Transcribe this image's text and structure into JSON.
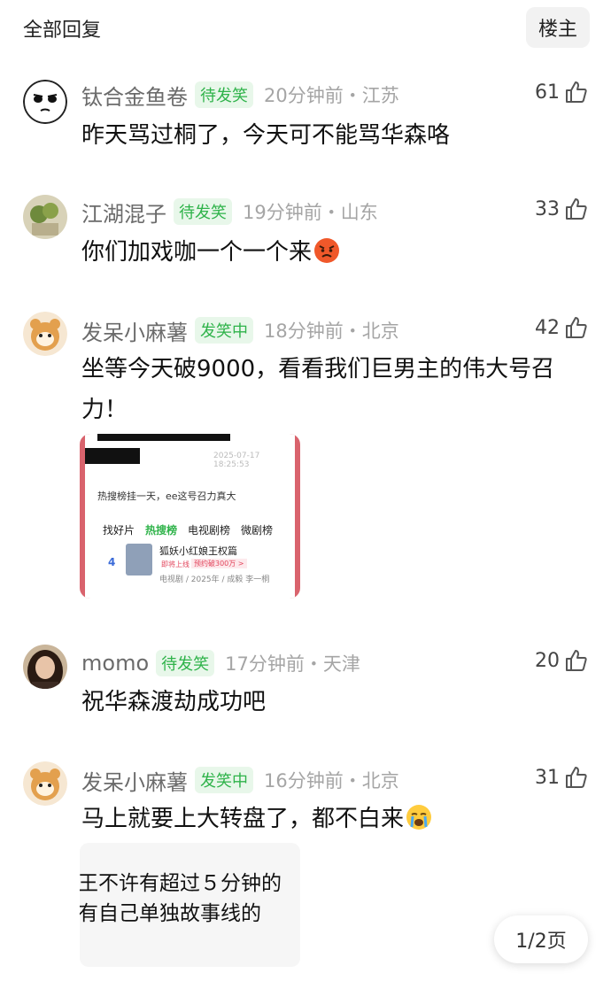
{
  "header": {
    "all_replies": "全部回复",
    "op_button": "楼主"
  },
  "comments": [
    {
      "user": "钛合金鱼卷",
      "badge": "待发笑",
      "time": "20分钟前・江苏",
      "likes": "61",
      "text": "昨天骂过桐了，今天可不能骂华森咯"
    },
    {
      "user": "江湖混子",
      "badge": "待发笑",
      "time": "19分钟前・山东",
      "likes": "33",
      "text": "你们加戏咖一个一个来"
    },
    {
      "user": "发呆小麻薯",
      "badge": "发笑中",
      "time": "18分钟前・北京",
      "likes": "42",
      "text": "坐等今天破9000，看看我们巨男主的伟大号召力！"
    },
    {
      "user": "momo",
      "badge": "待发笑",
      "time": "17分钟前・天津",
      "likes": "20",
      "text": "祝华森渡劫成功吧"
    },
    {
      "user": "发呆小麻薯",
      "badge": "发笑中",
      "time": "16分钟前・北京",
      "likes": "31",
      "text": "马上就要上大转盘了，都不白来"
    }
  ],
  "image1": {
    "stamp": "2025-07-17 18:25:53",
    "caption": "热搜榜挂一天，ee这号召力真大",
    "tabs": [
      "找好片",
      "热搜榜",
      "电视剧榜",
      "微剧榜"
    ],
    "rank": "4",
    "title": "狐妖小红娘王权篇",
    "tag_soon": "即将上线",
    "tag_reserve": "预约破300万 >",
    "info": "电视剧 / 2025年 / 成毅 李一桐"
  },
  "image2": {
    "line1": "王不许有超过５分钟的",
    "line2": "有自己单独故事线的"
  },
  "pager": {
    "label": "1/2页"
  },
  "icons": {
    "like": "thumb-up-icon",
    "angry_emoji": "angry-face-icon",
    "crying_emoji": "crying-face-icon"
  },
  "colors": {
    "badge_green": "#2fb34a",
    "badge_bg": "#e8f7ea",
    "meta_gray": "#a5a5a5"
  }
}
